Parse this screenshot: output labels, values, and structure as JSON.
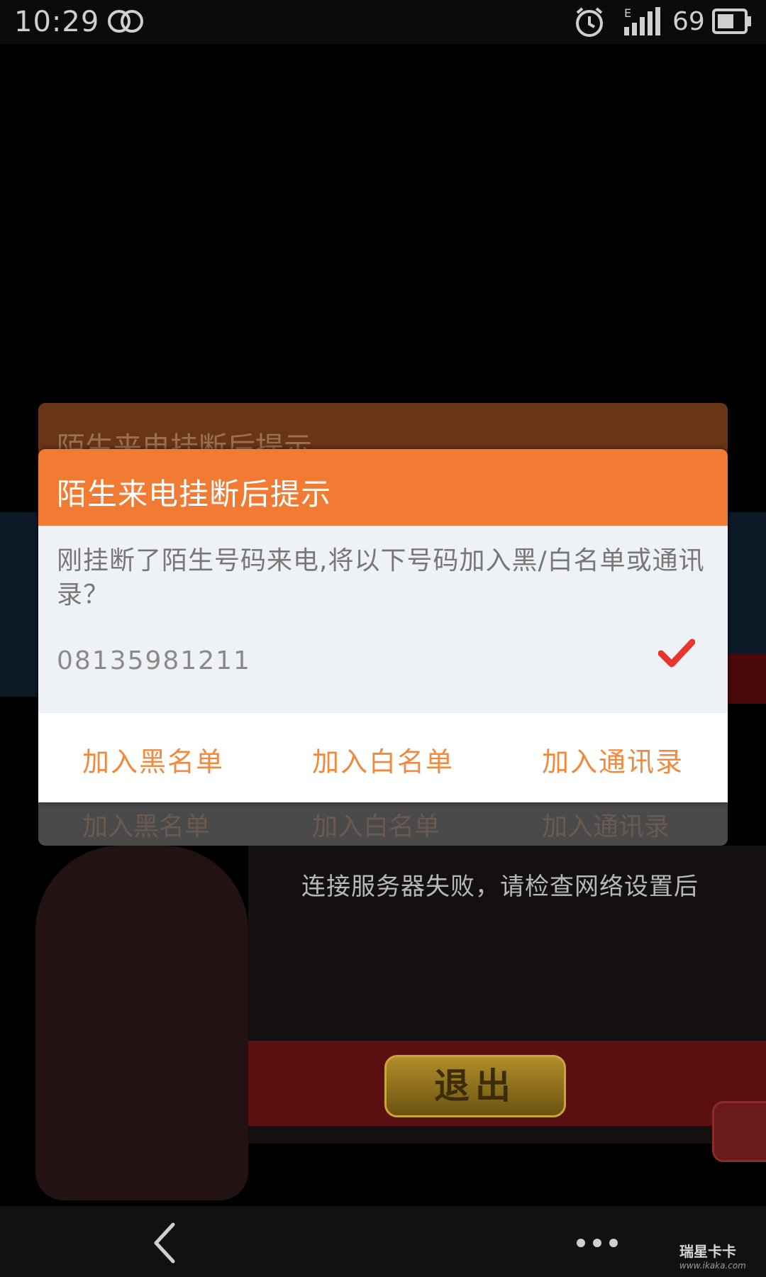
{
  "status_bar": {
    "time": "10:29",
    "network_type": "E",
    "battery_level": "69",
    "icons": [
      "dual-rings-icon",
      "alarm-icon",
      "signal-icon",
      "battery-icon"
    ]
  },
  "background_game": {
    "message": "连接服务器失败，请检查网络设置后",
    "exit_label": "退出"
  },
  "ghost_dialog": {
    "title": "陌生来电挂断后提示",
    "buttons": [
      "加入黑名单",
      "加入白名单",
      "加入通讯录"
    ]
  },
  "dialog": {
    "title": "陌生来电挂断后提示",
    "message": "刚挂断了陌生号码来电,将以下号码加入黑/白名单或通讯录？",
    "phone_number": "08135981211",
    "checked": true,
    "buttons": {
      "blacklist": "加入黑名单",
      "whitelist": "加入白名单",
      "contacts": "加入通讯录"
    },
    "accent_color": "#f17b33",
    "check_color": "#e8352f"
  },
  "nav_bar": {
    "icons": [
      "back-icon",
      "more-icon"
    ],
    "watermark": {
      "brand": "瑞星卡卡",
      "site": "www.ikaka.com"
    }
  }
}
